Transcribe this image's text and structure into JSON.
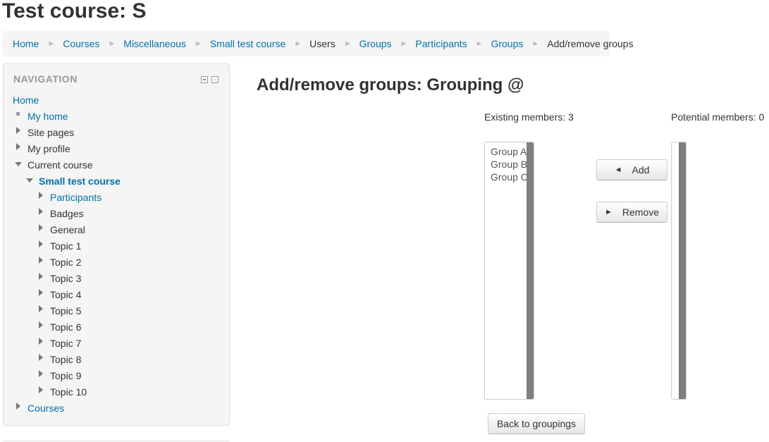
{
  "page_title": "Test course: S",
  "breadcrumb": [
    {
      "label": "Home",
      "link": true
    },
    {
      "label": "Courses",
      "link": true
    },
    {
      "label": "Miscellaneous",
      "link": true
    },
    {
      "label": "Small test course",
      "link": true
    },
    {
      "label": "Users",
      "link": false
    },
    {
      "label": "Groups",
      "link": true
    },
    {
      "label": "Participants",
      "link": true
    },
    {
      "label": "Groups",
      "link": true
    },
    {
      "label": "Add/remove groups",
      "link": false
    }
  ],
  "breadcrumb_separator": "►",
  "navigation": {
    "title": "NAVIGATION",
    "items": [
      {
        "label": "Home"
      },
      {
        "label": "My home"
      },
      {
        "label": "Site pages"
      },
      {
        "label": "My profile"
      },
      {
        "label": "Current course"
      },
      {
        "label": "Small test course"
      },
      {
        "label": "Participants"
      },
      {
        "label": "Badges"
      },
      {
        "label": "General"
      },
      {
        "label": "Topic 1"
      },
      {
        "label": "Topic 2"
      },
      {
        "label": "Topic 3"
      },
      {
        "label": "Topic 4"
      },
      {
        "label": "Topic 5"
      },
      {
        "label": "Topic 6"
      },
      {
        "label": "Topic 7"
      },
      {
        "label": "Topic 8"
      },
      {
        "label": "Topic 9"
      },
      {
        "label": "Topic 10"
      },
      {
        "label": "Courses"
      }
    ]
  },
  "main": {
    "heading": "Add/remove groups: Grouping @",
    "existing_label": "Existing members: 3",
    "potential_label": "Potential members: 0",
    "existing_options": [
      "Group A",
      "Group B",
      "Group C"
    ],
    "add_button": "Add",
    "add_arrow": "◄",
    "remove_button": "Remove",
    "remove_arrow": "►",
    "back_button": "Back to groupings"
  },
  "colors": {
    "link": "#0070a8",
    "text": "#333333",
    "block_bg": "#f5f5f5",
    "scrollbar": "#7f7f7f"
  }
}
